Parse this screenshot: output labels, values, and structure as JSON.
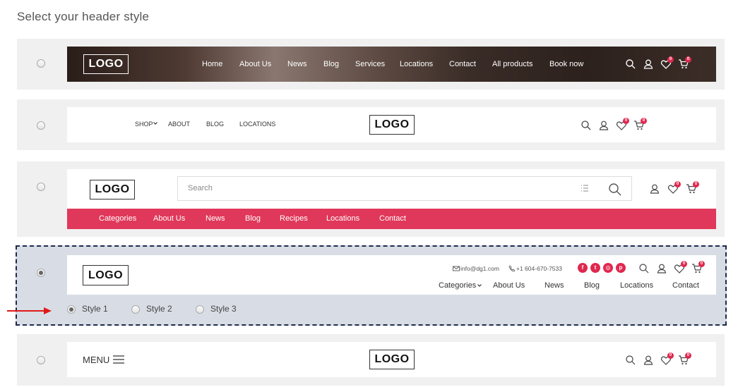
{
  "page": {
    "title": "Select your header style"
  },
  "colors": {
    "accent": "#e0284f",
    "red_bar": "#e0385a",
    "selected_bg": "#d8dde5",
    "selected_border": "#1d2a4a"
  },
  "logo_text": "LOGO",
  "header1": {
    "nav": [
      "Home",
      "About Us",
      "News",
      "Blog",
      "Services",
      "Locations",
      "Contact",
      "All products",
      "Book now"
    ],
    "wishlist_count": "0",
    "cart_count": "0"
  },
  "header2": {
    "nav": [
      "SHOP",
      "ABOUT",
      "BLOG",
      "LOCATIONS"
    ],
    "wishlist_count": "0",
    "cart_count": "0"
  },
  "header3": {
    "search_placeholder": "Search",
    "nav": [
      "Categories",
      "About Us",
      "News",
      "Blog",
      "Recipes",
      "Locations",
      "Contact"
    ],
    "wishlist_count": "0",
    "cart_count": "0"
  },
  "header4": {
    "email": "info@dg1.com",
    "phone": "+1 604-670-7533",
    "nav": [
      "Categories",
      "About Us",
      "News",
      "Blog",
      "Locations",
      "Contact"
    ],
    "wishlist_count": "0",
    "cart_count": "0",
    "styles": [
      "Style 1",
      "Style 2",
      "Style 3"
    ],
    "selected_style": "Style 1"
  },
  "header5": {
    "menu_label": "MENU",
    "wishlist_count": "0",
    "cart_count": "0"
  },
  "selected_header": 4
}
